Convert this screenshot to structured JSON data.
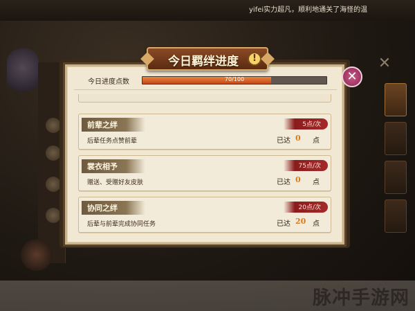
{
  "background": {
    "chat_message": "yifei实力超凡，顺利地通关了海怪的温",
    "watermark": "脉冲手游网"
  },
  "dialog": {
    "title": "今日羁绊进度",
    "info_icon": "info-icon",
    "close_icon": "close-icon",
    "progress": {
      "label": "今日进度点数",
      "current": 70,
      "max": 100,
      "text": "70/100"
    },
    "tasks": [
      {
        "name": "前辈之绊",
        "description": "后辈任务点赞前辈",
        "points": "5点/次",
        "done_label": "已达",
        "done_count": "0",
        "done_unit": "点"
      },
      {
        "name": "裳衣相予",
        "description": "赠送、受赠好友皮肤",
        "points": "75点/次",
        "done_label": "已达",
        "done_count": "0",
        "done_unit": "点"
      },
      {
        "name": "协同之绊",
        "description": "后辈与前辈完成协同任务",
        "points": "20点/次",
        "done_label": "已达",
        "done_count": "20",
        "done_unit": "点"
      }
    ]
  },
  "colors": {
    "progress_fill": "#c2461c",
    "done_count": "#d67a1e",
    "points_tag": "#a52a2a",
    "close_button": "#8a2653"
  }
}
